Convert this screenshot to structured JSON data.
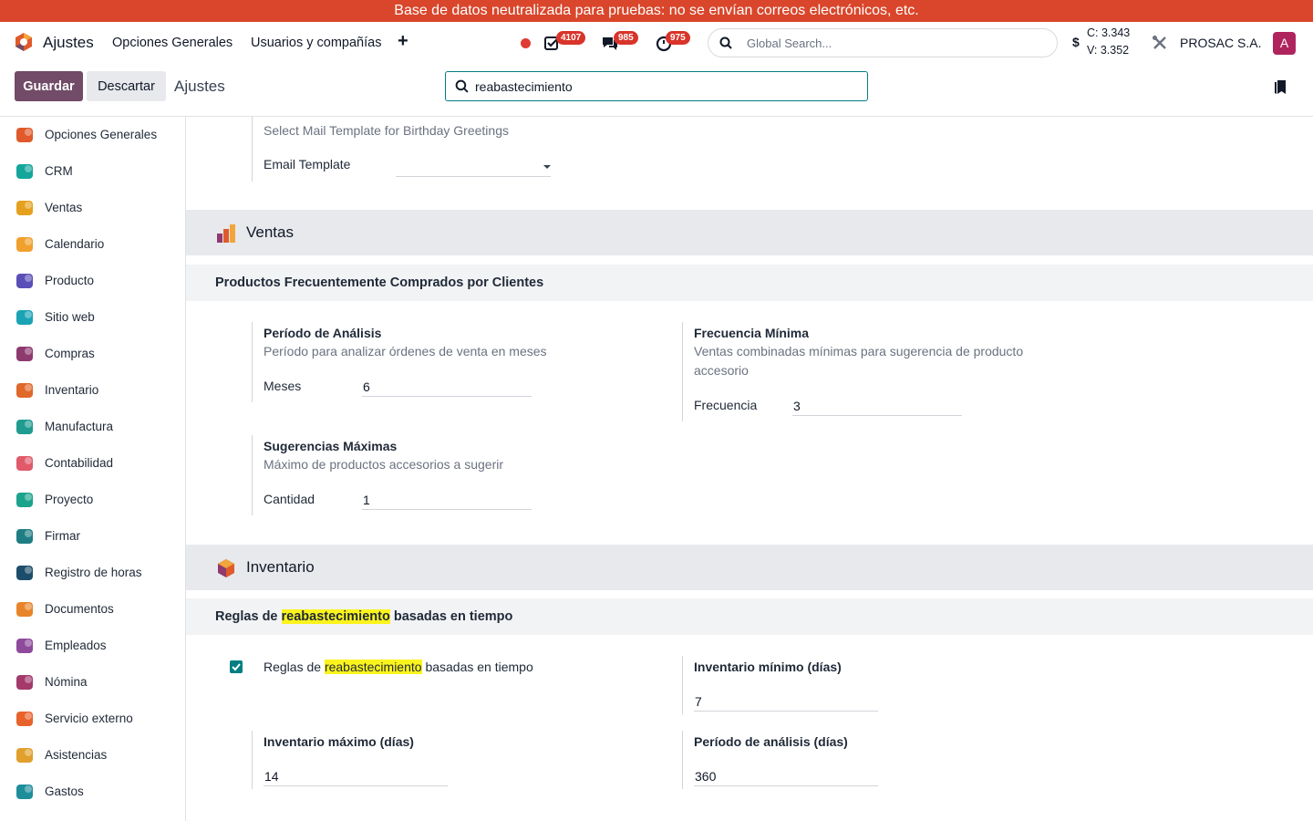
{
  "banner": "Base de datos neutralizada para pruebas: no se envían correos electrónicos, etc.",
  "navbar": {
    "app_name": "Ajustes",
    "menu": [
      "Opciones Generales",
      "Usuarios y compañías"
    ],
    "plus": "+",
    "badges": {
      "activities": "4107",
      "messages": "985",
      "timesheets": "975"
    },
    "search_placeholder": "Global Search...",
    "rate_symbol": "$",
    "rate_c": "C: 3.343",
    "rate_v": "V: 3.352",
    "company": "PROSAC S.A.",
    "avatar": "A"
  },
  "control": {
    "save": "Guardar",
    "discard": "Descartar",
    "breadcrumb": "Ajustes",
    "search_value": "reabastecimiento"
  },
  "sidebar": {
    "items": [
      {
        "label": "Opciones Generales",
        "icon": "settings-icon",
        "color": "#e05a2b"
      },
      {
        "label": "CRM",
        "icon": "crm-icon",
        "color": "#14a59b"
      },
      {
        "label": "Ventas",
        "icon": "sales-icon",
        "color": "#e5a11d"
      },
      {
        "label": "Calendario",
        "icon": "calendar-icon",
        "color": "#f0a02c"
      },
      {
        "label": "Producto",
        "icon": "product-icon",
        "color": "#5a4fb8"
      },
      {
        "label": "Sitio web",
        "icon": "website-icon",
        "color": "#1aa3b5"
      },
      {
        "label": "Compras",
        "icon": "purchase-icon",
        "color": "#8e3a6f"
      },
      {
        "label": "Inventario",
        "icon": "inventory-icon",
        "color": "#e0682b"
      },
      {
        "label": "Manufactura",
        "icon": "manufacturing-icon",
        "color": "#1f9c8f"
      },
      {
        "label": "Contabilidad",
        "icon": "accounting-icon",
        "color": "#e05a6a"
      },
      {
        "label": "Proyecto",
        "icon": "project-icon",
        "color": "#1ba38d"
      },
      {
        "label": "Firmar",
        "icon": "sign-icon",
        "color": "#1f7e84"
      },
      {
        "label": "Registro de horas",
        "icon": "timesheet-icon",
        "color": "#1c4e6b"
      },
      {
        "label": "Documentos",
        "icon": "documents-icon",
        "color": "#e8852a"
      },
      {
        "label": "Empleados",
        "icon": "employees-icon",
        "color": "#8e4a9b"
      },
      {
        "label": "Nómina",
        "icon": "payroll-icon",
        "color": "#a33a6b"
      },
      {
        "label": "Servicio externo",
        "icon": "field-service-icon",
        "color": "#e8622b"
      },
      {
        "label": "Asistencias",
        "icon": "attendances-icon",
        "color": "#e0a02b"
      },
      {
        "label": "Gastos",
        "icon": "expenses-icon",
        "color": "#1f8e9b"
      }
    ]
  },
  "main": {
    "birthday": {
      "desc": "Select Mail Template for Birthday Greetings",
      "field_label": "Email Template",
      "field_value": ""
    },
    "ventas": {
      "title": "Ventas",
      "section": "Productos Frecuentemente Comprados por Clientes",
      "analysis": {
        "title": "Período de Análisis",
        "desc": "Período para analizar órdenes de venta en meses",
        "label": "Meses",
        "value": "6"
      },
      "frequency": {
        "title": "Frecuencia Mínima",
        "desc_1": "Ventas combinadas mínimas para sugerencia de producto",
        "desc_2": "accesorio",
        "label": "Frecuencia",
        "value": "3"
      },
      "suggestions": {
        "title": "Sugerencias Máximas",
        "desc": "Máximo de productos accesorios a sugerir",
        "label": "Cantidad",
        "value": "1"
      }
    },
    "inventario": {
      "title": "Inventario",
      "section_pre": "Reglas de",
      "section_hl": "reabastecimiento",
      "section_post": "basadas en tiempo",
      "rule_pre": "Reglas de",
      "rule_hl": "reabastecimiento",
      "rule_post": "basadas en tiempo",
      "rule_checked": true,
      "min": {
        "title": "Inventario mínimo (días)",
        "value": "7"
      },
      "max": {
        "title": "Inventario máximo (días)",
        "value": "14"
      },
      "period": {
        "title": "Período de análisis (días)",
        "value": "360"
      }
    }
  }
}
